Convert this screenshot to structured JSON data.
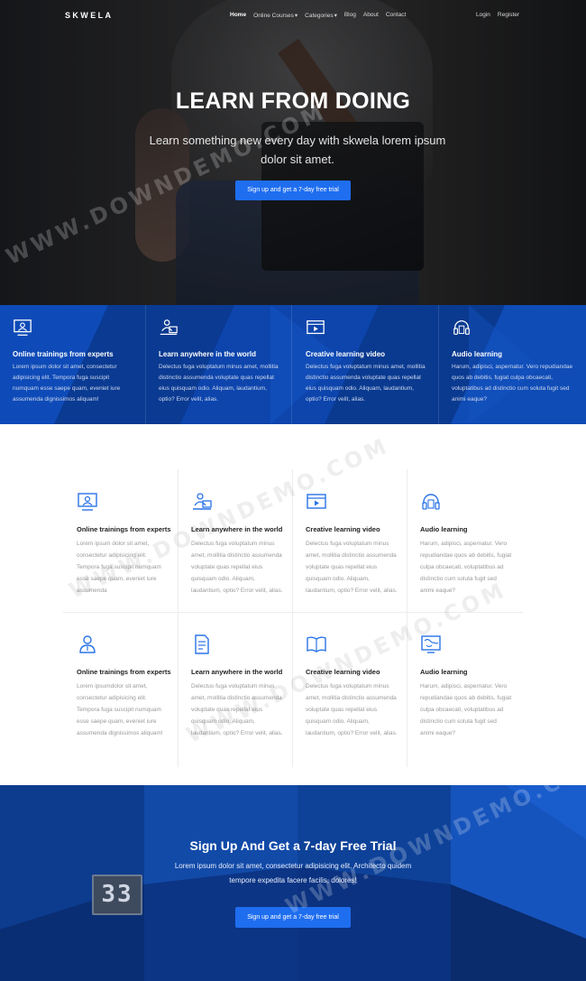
{
  "nav": {
    "brand": "SKWELA",
    "links": [
      {
        "label": "Home"
      },
      {
        "label": "Online Courses",
        "caret": "▾"
      },
      {
        "label": "Categories",
        "caret": "▾"
      },
      {
        "label": "Blog"
      },
      {
        "label": "About"
      },
      {
        "label": "Contact"
      }
    ],
    "login": "Login",
    "register": "Register"
  },
  "hero": {
    "title": "LEARN FROM DOING",
    "subtitle": "Learn something new every day with skwela lorem ipsum dolor sit amet.",
    "button": "Sign up and get a 7-day free trial"
  },
  "strip": [
    {
      "icon": "online-training-icon",
      "title": "Online trainings from experts",
      "text": "Lorem ipsum dolor sit amet, consectetur adipisicing elit. Tempora fuga suscipit numquam esse saepe quam, eveniet iure assumenda dignissimos aliquam!"
    },
    {
      "icon": "learn-anywhere-icon",
      "title": "Learn anywhere in the world",
      "text": "Delectus fuga voluptatum minus amet, mollitia distinctio assumenda voluptate quas repellat eius quisquam odio. Aliquam, laudantium, optio? Error velit, alias."
    },
    {
      "icon": "video-player-icon",
      "title": "Creative learning video",
      "text": "Delectus fuga voluptatum minus amet, mollitia distinctio assumenda voluptate quas repellat eius quisquam odio. Aliquam, laudantium, optio? Error velit, alias."
    },
    {
      "icon": "headphones-icon",
      "title": "Audio learning",
      "text": "Harum, adipisci, aspernatur. Vero repudiandae quos ab debitis, fugiat culpa obcaecati, voluptatibus ad distinctio cum soluta fugit sed animi eaque?"
    }
  ],
  "grid": [
    {
      "icon": "online-training-icon",
      "title": "Online trainings from experts",
      "text": "Lorem ipsum dolor sit amet, consectetur adipisicing elit. Tempora fuga suscipit numquam esse saepe quam, eveniet iure assumenda"
    },
    {
      "icon": "learn-anywhere-icon",
      "title": "Learn anywhere in the world",
      "text": "Delectus fuga voluptatum minus amet, mollitia distinctio assumenda voluptate quas repellat eius quisquam odio. Aliquam, laudantium, optio? Error velit, alias."
    },
    {
      "icon": "video-player-icon",
      "title": "Creative learning video",
      "text": "Delectus fuga voluptatum minus amet, mollitia distinctio assumenda voluptate quas repellat eius quisquam odio. Aliquam, laudantium, optio? Error velit, alias."
    },
    {
      "icon": "headphones-icon",
      "title": "Audio learning",
      "text": "Harum, adipisci, aspernatur. Vero repudiandae quos ab debitis, fugiat culpa obcaecati, voluptatibus ad distinctio cum soluta fugit sed animi eaque?"
    },
    {
      "icon": "expert-user-icon",
      "title": "Online trainings from experts",
      "text": "Lorem ipsumdolor sit amet, consectetur adipisicing elit. Tempora fuga suscipit numquam esse saepe quam, eveniet iure assumenda dignissimos aliquam!"
    },
    {
      "icon": "document-icon",
      "title": "Learn anywhere in the world",
      "text": "Delectus fuga voluptatum minus amet, mollitia distinctio assumenda voluptate quas repellat eius quisquam odio. Aliquam, laudantium, optio? Error velit, alias."
    },
    {
      "icon": "open-book-icon",
      "title": "Creative learning video",
      "text": "Delectus fuga voluptatum minus amet, mollitia distinctio assumenda voluptate quas repellat eius quisquam odio. Aliquam, laudantium, optio? Error velit, alias."
    },
    {
      "icon": "world-map-icon",
      "title": "Audio learning",
      "text": "Harum, adipisci, aspernatur. Vero repudiandae quos ab debitis, fugiat culpa obcaecati, voluptatibus ad distinctio cum soluta fugit sed animi eaque?"
    }
  ],
  "cta": {
    "title": "Sign Up And Get a 7-day Free Trial",
    "text": "Lorem ipsum dolor sit amet, consectetur adipisicing elit. Architecto quidem tempore expedita facere facilis, dolores!",
    "button": "Sign up and get a 7-day free trial",
    "sign_number": "33"
  },
  "watermark": "WWW.DOWNDEMO.COM",
  "colors": {
    "accent": "#1f6ef0",
    "strip": "#0c3d9a",
    "cta": "#0a2a66",
    "icon_blue": "#2a73e8"
  }
}
